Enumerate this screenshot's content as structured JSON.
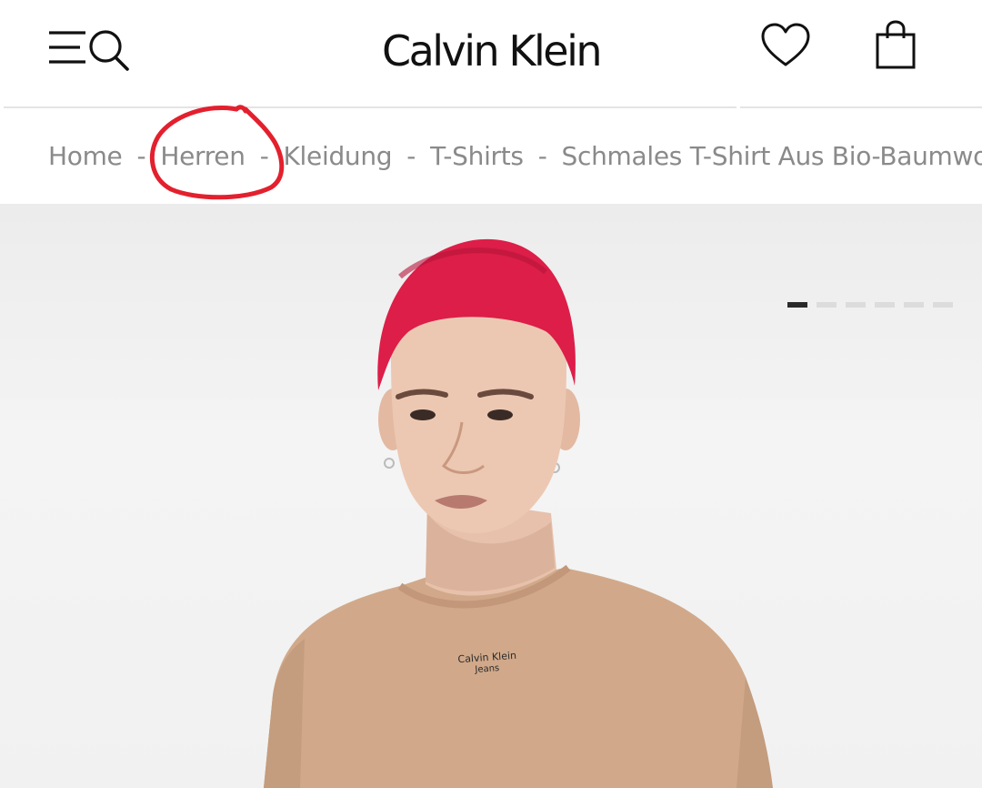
{
  "header": {
    "brand": "Calvin Klein",
    "icons": [
      "menu-icon",
      "search-icon",
      "heart-icon",
      "shopping-bag-icon"
    ]
  },
  "breadcrumb": {
    "items": [
      {
        "label": "Home"
      },
      {
        "label": "Herren"
      },
      {
        "label": "Kleidung"
      },
      {
        "label": "T-Shirts"
      },
      {
        "label": "Schmales T-Shirt Aus Bio-Baumwolle"
      }
    ],
    "separator": "-"
  },
  "product": {
    "shirt_logo_line1": "Calvin Klein",
    "shirt_logo_line2": "Jeans",
    "image_count": 6,
    "active_image": 1
  },
  "annotation": {
    "color": "#e3202e"
  }
}
